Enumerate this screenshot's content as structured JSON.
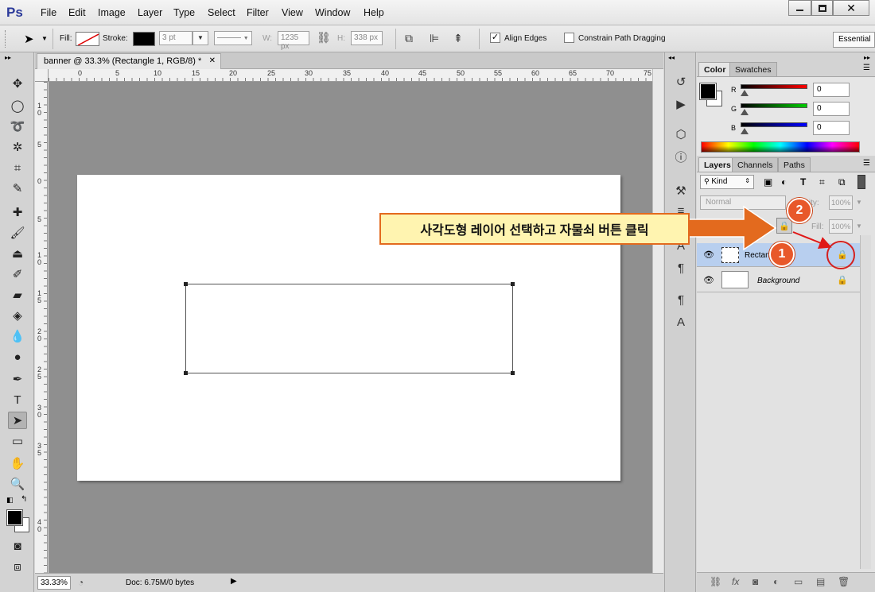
{
  "app": {
    "logo_text": "Ps",
    "menus": [
      "File",
      "Edit",
      "Image",
      "Layer",
      "Type",
      "Select",
      "Filter",
      "View",
      "Window",
      "Help"
    ],
    "window_controls": [
      "minimize",
      "maximize",
      "close"
    ]
  },
  "options_bar": {
    "fill_label": "Fill:",
    "stroke_label": "Stroke:",
    "stroke_width": "3 pt",
    "w_label": "W:",
    "w_value": "1235 px",
    "h_label": "H:",
    "h_value": "338 px",
    "align_edges_label": "Align Edges",
    "align_edges_checked": true,
    "constrain_label": "Constrain Path Dragging",
    "constrain_checked": false,
    "workspace_label": "Essential"
  },
  "document": {
    "tab_title": "banner @ 33.3% (Rectangle 1, RGB/8) *",
    "ruler_h_ticks": [
      "0",
      "5",
      "10",
      "15",
      "20",
      "25",
      "30",
      "35",
      "40",
      "45",
      "50",
      "55",
      "60",
      "65",
      "70",
      "75"
    ],
    "ruler_v_ticks": [
      "1\n0",
      "5",
      "0",
      "5",
      "1\n0",
      "1\n5",
      "2\n0",
      "2\n5",
      "3\n0",
      "3\n5",
      "4\n0"
    ],
    "zoom": "33.33%",
    "doc_info": "Doc: 6.75M/0 bytes"
  },
  "color_panel": {
    "tabs": [
      "Color",
      "Swatches"
    ],
    "channels": [
      {
        "label": "R",
        "value": "0",
        "color": "#cc0000"
      },
      {
        "label": "G",
        "value": "0",
        "color": "#00aa00"
      },
      {
        "label": "B",
        "value": "0",
        "color": "#0000cc"
      }
    ]
  },
  "layers_panel": {
    "tabs": [
      "Layers",
      "Channels",
      "Paths"
    ],
    "kind_label": "Kind",
    "blend_mode": "Normal",
    "opacity_label": "Opacity:",
    "opacity_value": "100%",
    "fill_label": "Fill:",
    "fill_value": "100%",
    "layers": [
      {
        "name": "Rectangle 1",
        "selected": true
      },
      {
        "name": "Background",
        "selected": false
      }
    ]
  },
  "annotation": {
    "callout_text": "사각도형 레이어 선택하고 자물쇠 버튼 클릭",
    "badge_1": "1",
    "badge_2": "2",
    "accent_color": "#e8582a"
  }
}
